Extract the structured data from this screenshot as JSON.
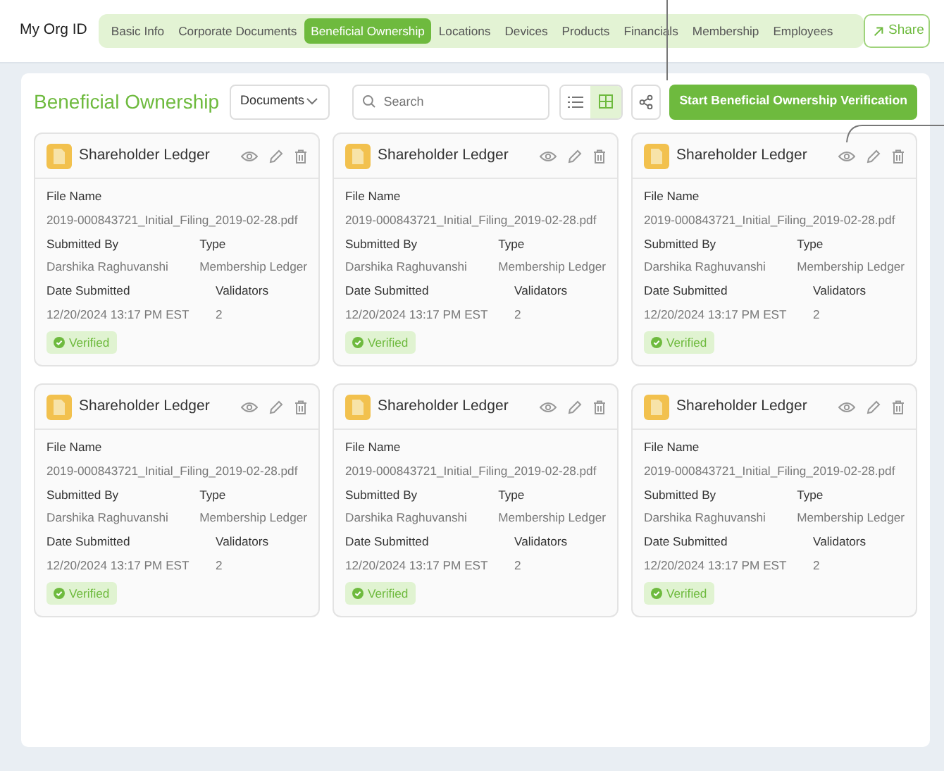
{
  "org_label": "My Org ID",
  "tabs": [
    {
      "label": "Basic Info",
      "selected": false
    },
    {
      "label": "Corporate Documents",
      "selected": false
    },
    {
      "label": "Beneficial Ownership",
      "selected": true
    },
    {
      "label": "Locations",
      "selected": false
    },
    {
      "label": "Devices",
      "selected": false
    },
    {
      "label": "Products",
      "selected": false
    },
    {
      "label": "Financials",
      "selected": false
    },
    {
      "label": "Membership",
      "selected": false
    },
    {
      "label": "Employees",
      "selected": false
    }
  ],
  "share_button": "Share",
  "page_title": "Beneficial Ownership",
  "filter_dropdown": {
    "value": "Documents"
  },
  "search": {
    "placeholder": "Search"
  },
  "view_toggle": [
    {
      "kind": "list",
      "selected": false
    },
    {
      "kind": "grid",
      "selected": true
    }
  ],
  "primary_button": "Start Beneficial Ownership Verification",
  "cards": [
    {
      "title": "Shareholder Ledger",
      "file_name_label": "File Name",
      "file_name": "2019-000843721_Initial_Filing_2019-02-28.pdf",
      "submitted_by_label": "Submitted By",
      "submitted_by": "Darshika Raghuvanshi",
      "type_label": "Type",
      "type": "Membership Ledger",
      "date_label": "Date Submitted",
      "date": "12/20/2024 13:17 PM EST",
      "validators_label": "Validators",
      "validators": "2",
      "status": "Verified"
    },
    {
      "title": "Shareholder Ledger",
      "file_name_label": "File Name",
      "file_name": "2019-000843721_Initial_Filing_2019-02-28.pdf",
      "submitted_by_label": "Submitted By",
      "submitted_by": "Darshika Raghuvanshi",
      "type_label": "Type",
      "type": "Membership Ledger",
      "date_label": "Date Submitted",
      "date": "12/20/2024 13:17 PM EST",
      "validators_label": "Validators",
      "validators": "2",
      "status": "Verified"
    },
    {
      "title": "Shareholder Ledger",
      "file_name_label": "File Name",
      "file_name": "2019-000843721_Initial_Filing_2019-02-28.pdf",
      "submitted_by_label": "Submitted By",
      "submitted_by": "Darshika Raghuvanshi",
      "type_label": "Type",
      "type": "Membership Ledger",
      "date_label": "Date Submitted",
      "date": "12/20/2024 13:17 PM EST",
      "validators_label": "Validators",
      "validators": "2",
      "status": "Verified"
    },
    {
      "title": "Shareholder Ledger",
      "file_name_label": "File Name",
      "file_name": "2019-000843721_Initial_Filing_2019-02-28.pdf",
      "submitted_by_label": "Submitted By",
      "submitted_by": "Darshika Raghuvanshi",
      "type_label": "Type",
      "type": "Membership Ledger",
      "date_label": "Date Submitted",
      "date": "12/20/2024 13:17 PM EST",
      "validators_label": "Validators",
      "validators": "2",
      "status": "Verified"
    },
    {
      "title": "Shareholder Ledger",
      "file_name_label": "File Name",
      "file_name": "2019-000843721_Initial_Filing_2019-02-28.pdf",
      "submitted_by_label": "Submitted By",
      "submitted_by": "Darshika Raghuvanshi",
      "type_label": "Type",
      "type": "Membership Ledger",
      "date_label": "Date Submitted",
      "date": "12/20/2024 13:17 PM EST",
      "validators_label": "Validators",
      "validators": "2",
      "status": "Verified"
    },
    {
      "title": "Shareholder Ledger",
      "file_name_label": "File Name",
      "file_name": "2019-000843721_Initial_Filing_2019-02-28.pdf",
      "submitted_by_label": "Submitted By",
      "submitted_by": "Darshika Raghuvanshi",
      "type_label": "Type",
      "type": "Membership Ledger",
      "date_label": "Date Submitted",
      "date": "12/20/2024 13:17 PM EST",
      "validators_label": "Validators",
      "validators": "2",
      "status": "Verified"
    }
  ]
}
